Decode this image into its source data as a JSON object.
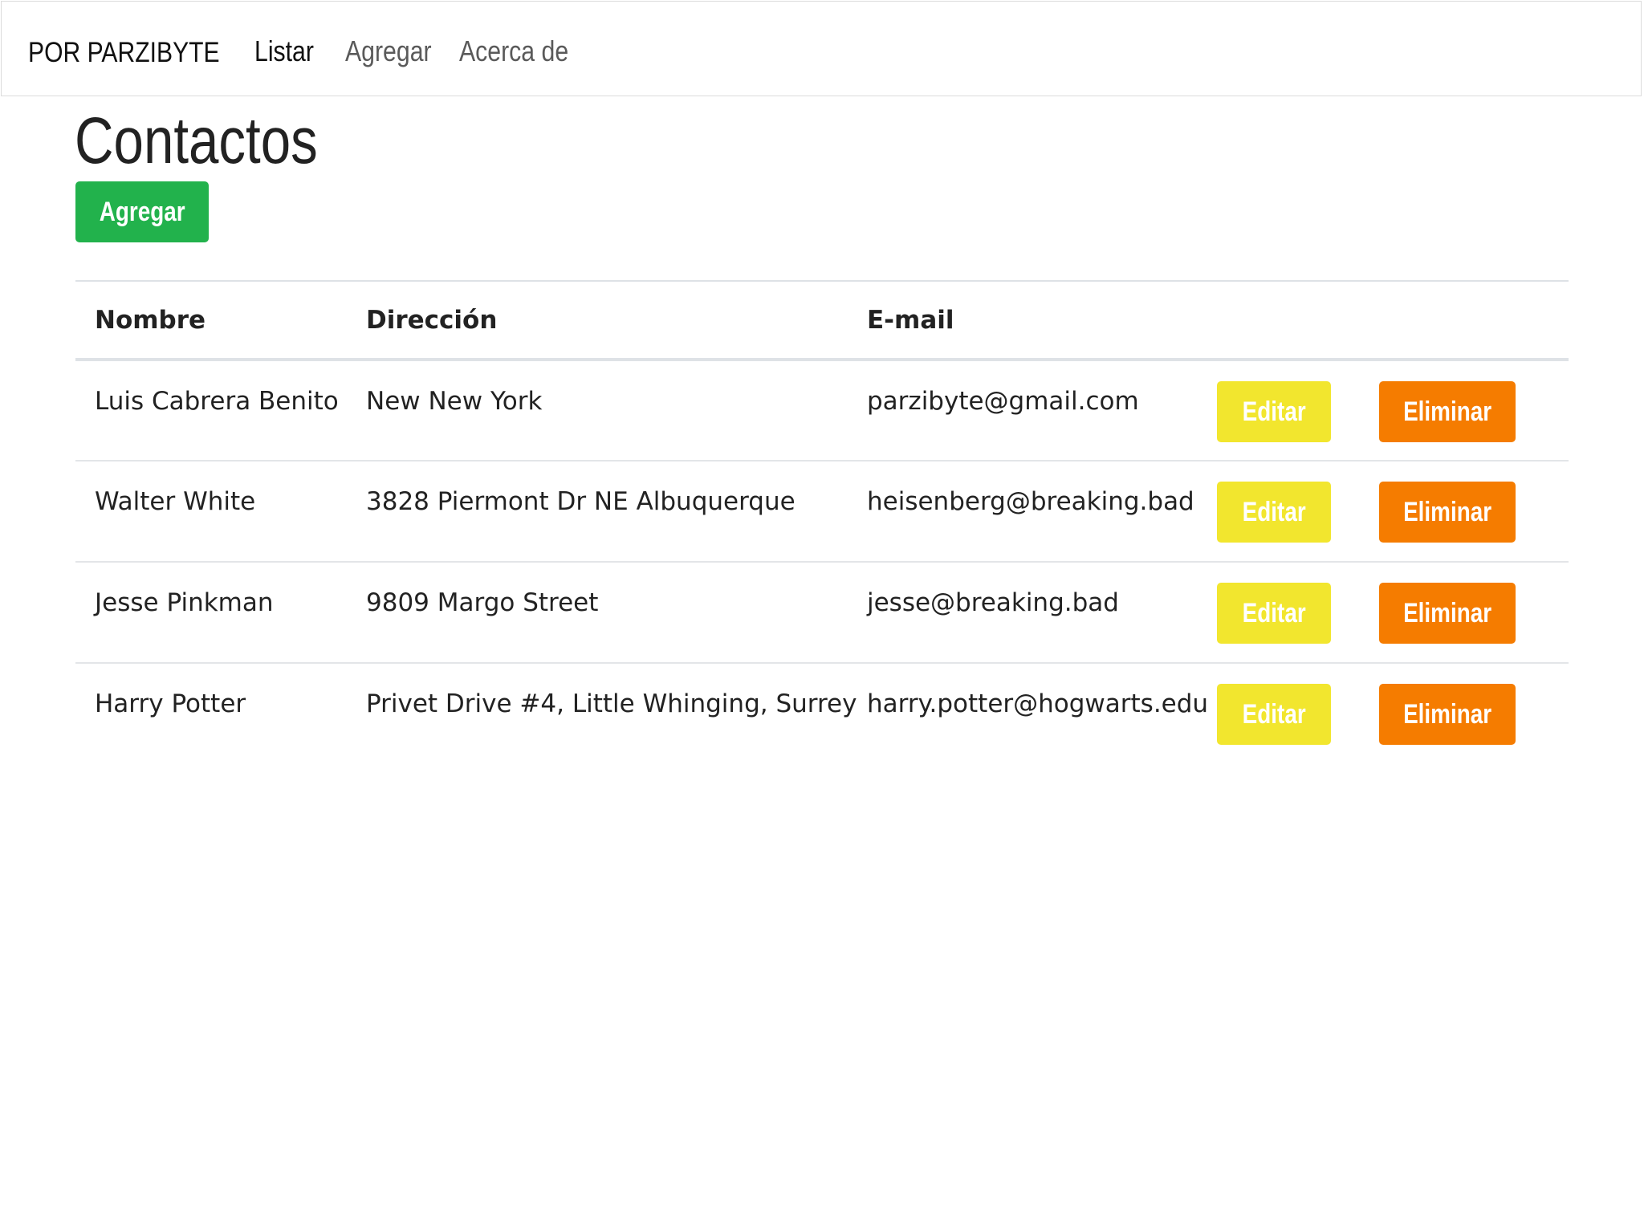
{
  "navbar": {
    "brand": "POR PARZIBYTE",
    "items": [
      {
        "label": "Listar",
        "active": true
      },
      {
        "label": "Agregar",
        "active": false
      },
      {
        "label": "Acerca de",
        "active": false
      }
    ]
  },
  "main": {
    "title": "Contactos",
    "add_button": "Agregar"
  },
  "table": {
    "headers": [
      "Nombre",
      "Dirección",
      "E-mail",
      ""
    ],
    "rows": [
      {
        "nombre": "Luis Cabrera Benito",
        "direccion": "New New York",
        "email": "parzibyte@gmail.com",
        "edit": "Editar",
        "delete": "Eliminar"
      },
      {
        "nombre": "Walter White",
        "direccion": "3828 Piermont Dr NE Albuquerque",
        "email": "heisenberg@breaking.bad",
        "edit": "Editar",
        "delete": "Eliminar"
      },
      {
        "nombre": "Jesse Pinkman",
        "direccion": "9809 Margo Street",
        "email": "jesse@breaking.bad",
        "edit": "Editar",
        "delete": "Eliminar"
      },
      {
        "nombre": "Harry Potter",
        "direccion": "Privet Drive #4, Little Whinging, Surrey",
        "email": "harry.potter@hogwarts.edu",
        "edit": "Editar",
        "delete": "Eliminar"
      }
    ]
  },
  "colors": {
    "add": "#22b24c",
    "edit": "#f2e62e",
    "delete": "#f57c00"
  }
}
